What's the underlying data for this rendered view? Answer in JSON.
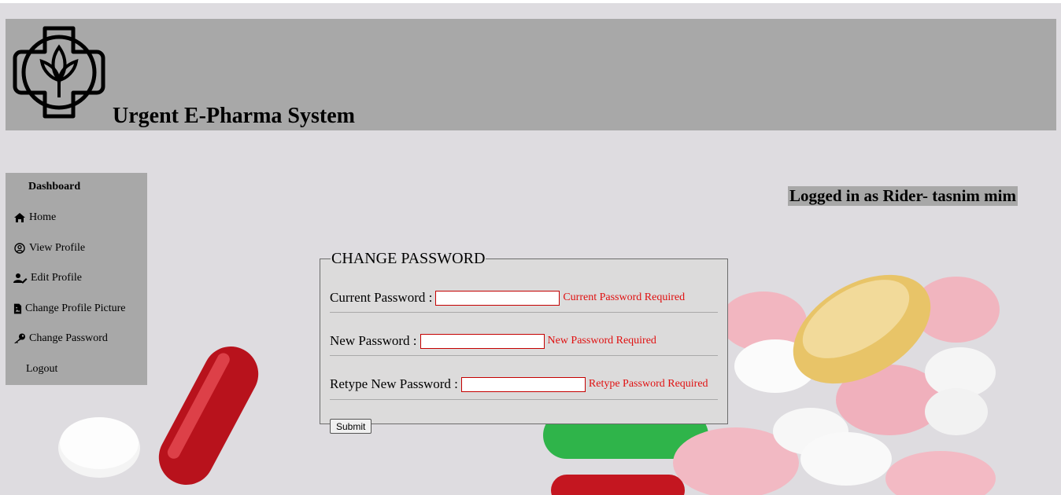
{
  "site": {
    "title": "Urgent E-Pharma System",
    "logo_icon": "pharmacy-cross-leaf-logo"
  },
  "sidebar": {
    "title": "Dashboard",
    "items": [
      {
        "label": "Home",
        "icon": "home-icon"
      },
      {
        "label": "View Profile",
        "icon": "user-circle-icon"
      },
      {
        "label": "Edit Profile",
        "icon": "user-edit-icon"
      },
      {
        "label": "Change Profile Picture",
        "icon": "file-image-icon"
      },
      {
        "label": "Change Password",
        "icon": "key-icon"
      },
      {
        "label": "Logout",
        "icon": ""
      }
    ]
  },
  "status": {
    "logged_in_text": "Logged in as Rider- tasnim mim"
  },
  "form": {
    "legend": "CHANGE PASSWORD",
    "fields": [
      {
        "label": "Current Password :",
        "value": "",
        "error": "Current Password Required"
      },
      {
        "label": "New Password :",
        "value": "",
        "error": "New Password Required"
      },
      {
        "label": "Retype New Password :",
        "value": "",
        "error": "Retype Password Required"
      }
    ],
    "submit_label": "Submit"
  },
  "colors": {
    "panel_gray": "#a8a8a8",
    "error_red": "#e01010",
    "page_bg": "#dedce0"
  }
}
